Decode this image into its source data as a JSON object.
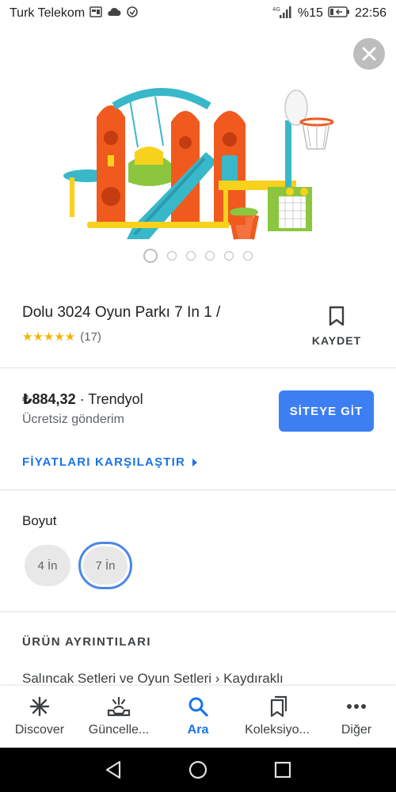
{
  "status_bar": {
    "carrier": "Turk Telekom",
    "battery_percent": "%15",
    "time": "22:56"
  },
  "product": {
    "title": "Dolu 3024 Oyun Parkı 7 In 1 /",
    "stars": "★★★★★",
    "review_count": "(17)",
    "save_label": "KAYDET",
    "image_count": 6,
    "active_image_index": 0
  },
  "offer": {
    "price": "₺884,32",
    "separator": " · ",
    "seller": "Trendyol",
    "shipping": "Ücretsiz gönderim",
    "cta_label": "SİTEYE GİT",
    "compare_label": "FİYATLARI KARŞILAŞTIR"
  },
  "size": {
    "label": "Boyut",
    "options": [
      "4 İn",
      "7 İn"
    ],
    "selected": "7 İn"
  },
  "details": {
    "heading": "ÜRÜN AYRINTILARI",
    "breadcrumb": "Salıncak Setleri ve Oyun Setleri › Kaydıraklı"
  },
  "bottom_nav": {
    "items": [
      {
        "label": "Discover",
        "icon": "asterisk-icon"
      },
      {
        "label": "Güncelle...",
        "icon": "updates-icon"
      },
      {
        "label": "Ara",
        "icon": "search-icon"
      },
      {
        "label": "Koleksiyo...",
        "icon": "collections-icon"
      },
      {
        "label": "Diğer",
        "icon": "more-icon"
      }
    ],
    "active": "Ara"
  },
  "colors": {
    "accent": "#1a73e8",
    "button": "#3d7ff3",
    "star": "#f4b400"
  }
}
